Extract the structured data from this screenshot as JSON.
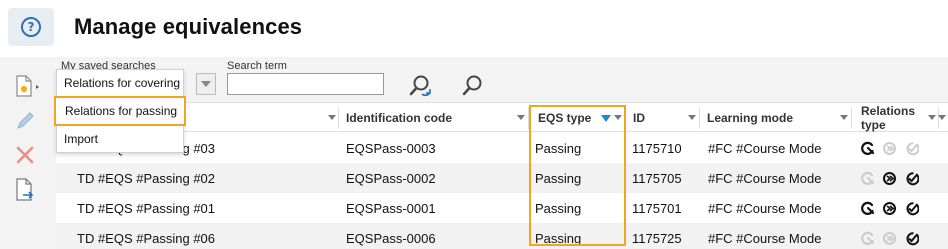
{
  "header": {
    "title": "Manage equivalences",
    "help_icon": "question-circle-icon"
  },
  "toolbar": {
    "new_icon": "new-document-icon",
    "edit_icon": "pencil-icon",
    "delete_icon": "delete-x-icon",
    "export_icon": "export-document-icon"
  },
  "search": {
    "saved_label": "My saved searches",
    "term_label": "Search term",
    "term_value": "",
    "advanced_search_icon": "advanced-search-icon",
    "search_icon": "search-icon"
  },
  "menu": {
    "items": [
      "Relations for covering",
      "Relations for passing",
      "Import"
    ],
    "highlighted_index": 1
  },
  "table": {
    "columns": [
      "Identification code",
      "EQS type",
      "ID",
      "Learning mode",
      "Relations type"
    ],
    "sorted_column": "EQS type",
    "rows": [
      {
        "name": "TD #EQS #Passing #03",
        "code": "EQSPass-0003",
        "type": "Passing",
        "id": "1175710",
        "mode": "#FC #Course Mode",
        "relations": [
          true,
          false,
          false
        ]
      },
      {
        "name": "TD #EQS #Passing #02",
        "code": "EQSPass-0002",
        "type": "Passing",
        "id": "1175705",
        "mode": "#FC #Course Mode",
        "relations": [
          false,
          true,
          true
        ]
      },
      {
        "name": "TD #EQS #Passing #01",
        "code": "EQSPass-0001",
        "type": "Passing",
        "id": "1175701",
        "mode": "#FC #Course Mode",
        "relations": [
          true,
          true,
          true
        ]
      },
      {
        "name": "TD #EQS #Passing #06",
        "code": "EQSPass-0006",
        "type": "Passing",
        "id": "1175725",
        "mode": "#FC #Course Mode",
        "relations": [
          false,
          false,
          true
        ]
      }
    ]
  },
  "colors": {
    "accent": "#f2a51e",
    "brand_blue": "#2e6fb7",
    "sort_arrow": "#1e88d6"
  }
}
